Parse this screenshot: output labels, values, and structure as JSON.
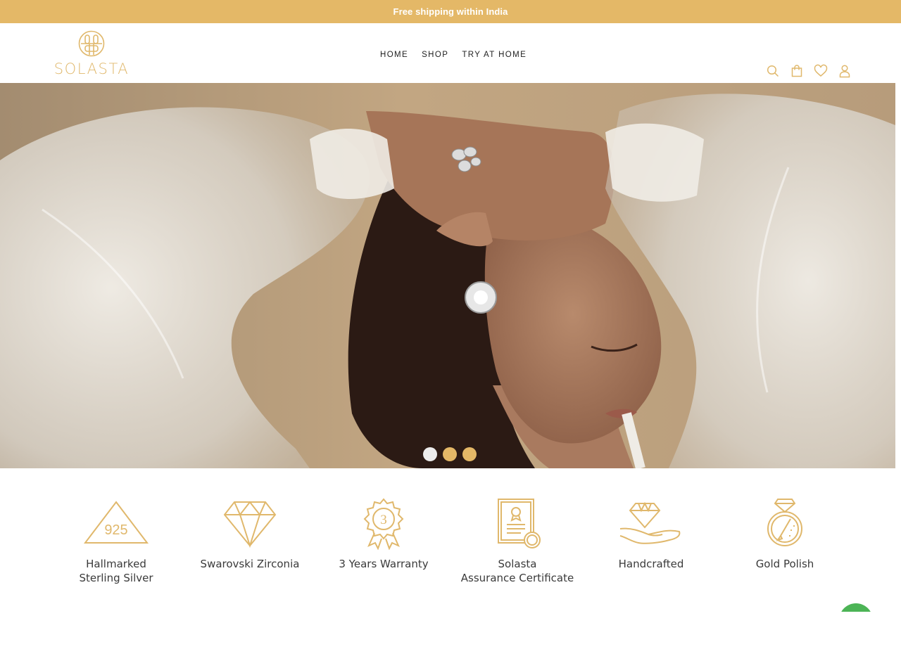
{
  "announcement": {
    "text": "Free shipping within India"
  },
  "header": {
    "brand": "SOLASTA",
    "nav": [
      {
        "label": "HOME"
      },
      {
        "label": "SHOP"
      },
      {
        "label": "TRY AT HOME"
      }
    ],
    "icons": [
      "search-icon",
      "bag-icon",
      "heart-icon",
      "user-icon"
    ]
  },
  "hero": {
    "slides_total": 3,
    "active_slide": 1
  },
  "features": [
    {
      "icon": "hallmark-925-icon",
      "line1": "Hallmarked",
      "line2": "Sterling Silver",
      "badge": "925"
    },
    {
      "icon": "diamond-icon",
      "line1": "Swarovski Zirconia",
      "line2": ""
    },
    {
      "icon": "warranty-badge-icon",
      "line1": "3 Years Warranty",
      "line2": "",
      "badge": "3"
    },
    {
      "icon": "certificate-icon",
      "line1": "Solasta",
      "line2": "Assurance Certificate"
    },
    {
      "icon": "handcrafted-icon",
      "line1": "Handcrafted",
      "line2": ""
    },
    {
      "icon": "gold-polish-icon",
      "line1": "Gold Polish",
      "line2": ""
    }
  ],
  "colors": {
    "accent": "#e4b867",
    "icon_gold": "#e0b86c",
    "chat_green": "#4cb456"
  }
}
